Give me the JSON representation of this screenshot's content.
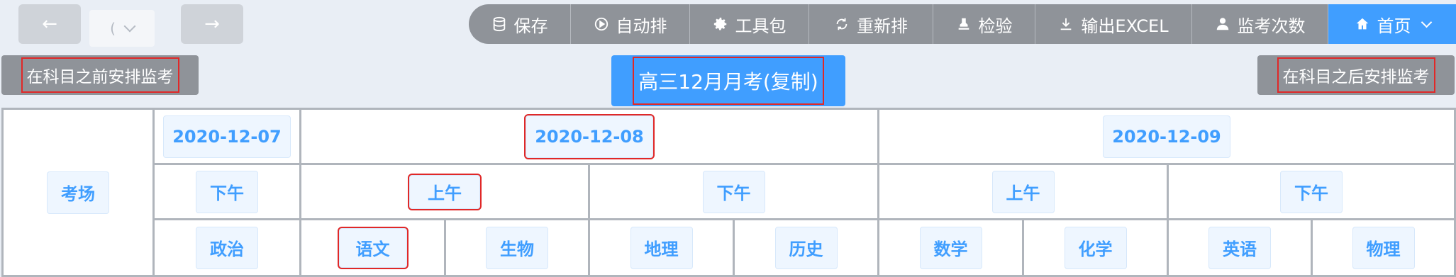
{
  "nav": {
    "back_icon": "arrow-left-icon",
    "forward_icon": "arrow-right-icon",
    "select_value": "(",
    "select_icon": "chevron-down-icon"
  },
  "toolbar": {
    "save": "保存",
    "auto_arrange": "自动排",
    "toolkit": "工具包",
    "rearrange": "重新排",
    "check": "检验",
    "export_excel": "输出EXCEL",
    "proctor_count": "监考次数",
    "home": "首页"
  },
  "actions": {
    "before_subject": "在科目之前安排监考",
    "exam_title": "高三12月月考(复制)",
    "after_subject": "在科目之后安排监考"
  },
  "grid": {
    "room_label": "考场",
    "dates": [
      "2020-12-07",
      "2020-12-08",
      "2020-12-09"
    ],
    "sessions": [
      "下午",
      "上午",
      "下午",
      "上午",
      "下午"
    ],
    "subjects": [
      "政治",
      "语文",
      "生物",
      "地理",
      "历史",
      "数学",
      "化学",
      "英语",
      "物理"
    ]
  },
  "colors": {
    "toolbar_gray": "#8f9399",
    "accent_blue": "#409eff",
    "highlight_red": "#e02828"
  }
}
